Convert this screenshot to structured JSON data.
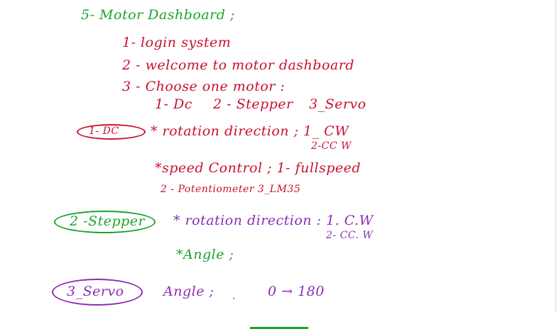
{
  "title": "5- Motor Dashboard ;",
  "steps": [
    "1- login system",
    "2 - welcome to motor dashboard",
    "3 - Choose one motor :"
  ],
  "motor_options": {
    "dc": "1- Dc",
    "stepper": "2 - Stepper",
    "servo": "3_Servo"
  },
  "dc_section": {
    "label": "1- DC",
    "rotation": "* rotation direction ; 1_ CW",
    "rotation_alt": "2-CC W",
    "speed": "*speed Control ; 1- fullspeed",
    "speed_options": "2 - Potentiometer  3_LM35"
  },
  "stepper_section": {
    "label": "2 -Stepper",
    "rotation": "* rotation direction : 1. C.W",
    "rotation_alt": "2- CC. W",
    "angle": "*Angle ;"
  },
  "servo_section": {
    "label": "3_Servo",
    "angle": "Angle ;",
    "range": "0 → 180"
  },
  "colors": {
    "green": "#1aa52a",
    "red": "#c8102e",
    "purple": "#8d2bb5",
    "background": "#ffffff"
  }
}
